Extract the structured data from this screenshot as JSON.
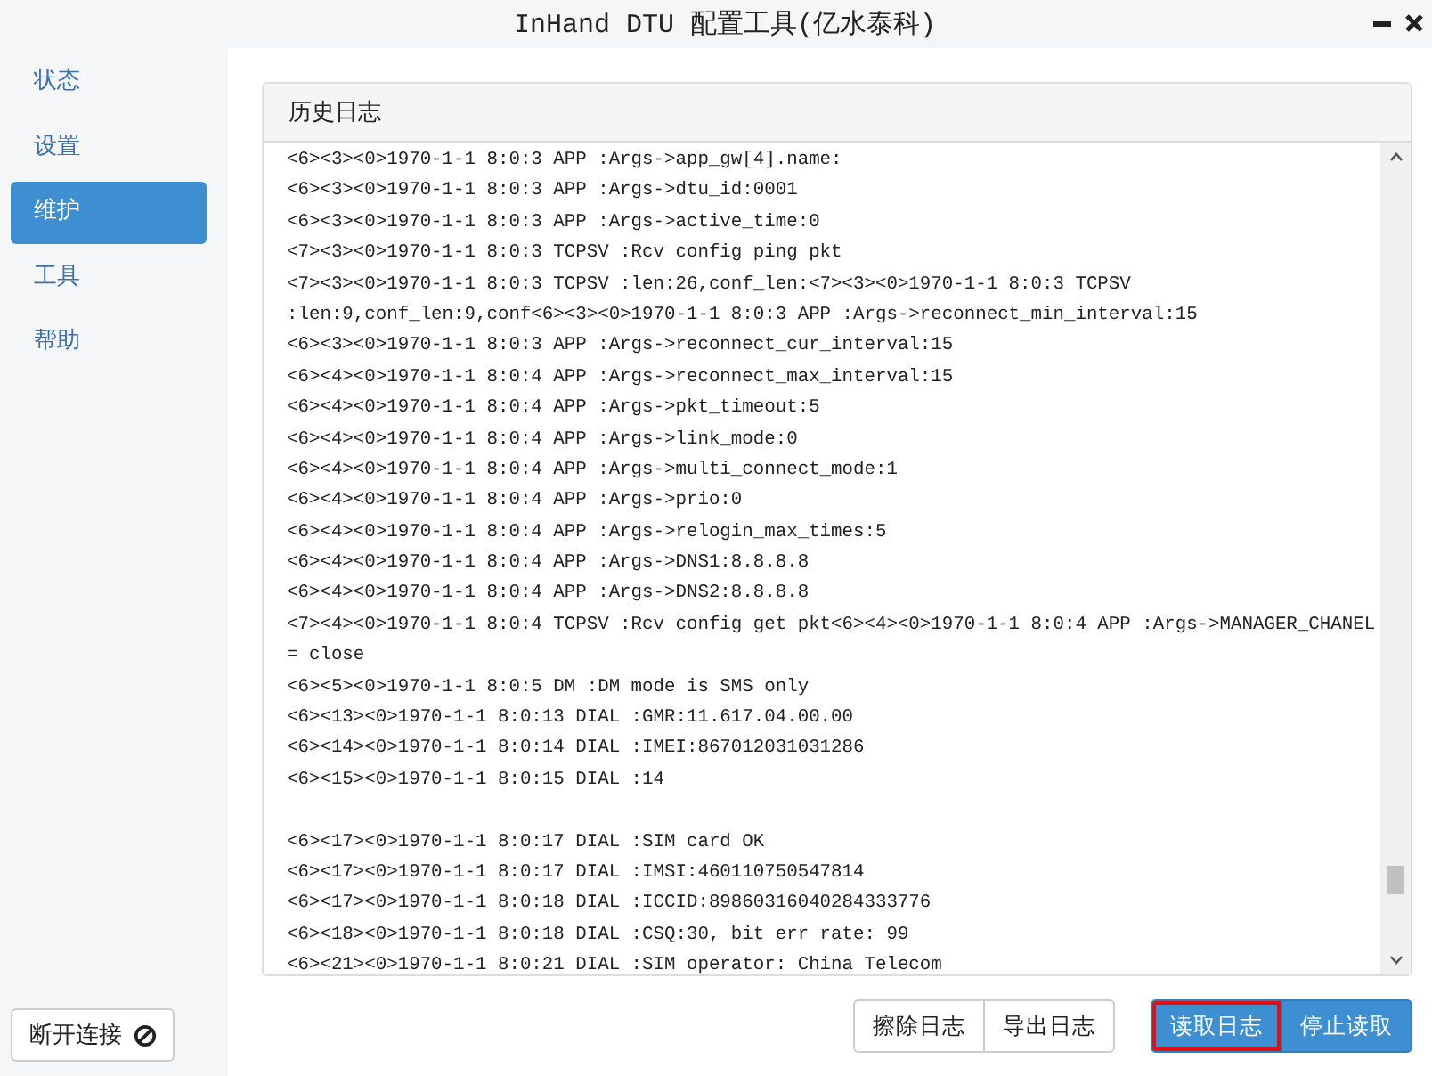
{
  "window": {
    "title": "InHand DTU 配置工具(亿水泰科)"
  },
  "sidebar": {
    "items": [
      {
        "label": "状态",
        "selected": false
      },
      {
        "label": "设置",
        "selected": false
      },
      {
        "label": "维护",
        "selected": true
      },
      {
        "label": "工具",
        "selected": false
      },
      {
        "label": "帮助",
        "selected": false
      }
    ],
    "disconnect_button": {
      "label": "断开连接"
    }
  },
  "log_panel": {
    "title": "历史日志",
    "blocks": [
      [
        "<6><3><0>1970-1-1 8:0:3 APP :Args->app_gw[4].name:",
        "<6><3><0>1970-1-1 8:0:3 APP :Args->dtu_id:0001",
        "<6><3><0>1970-1-1 8:0:3 APP :Args->active_time:0",
        "<7><3><0>1970-1-1 8:0:3 TCPSV :Rcv config ping pkt",
        "<7><3><0>1970-1-1 8:0:3 TCPSV :len:26,conf_len:<7><3><0>1970-1-1 8:0:3 TCPSV",
        ":len:9,conf_len:9,conf<6><3><0>1970-1-1 8:0:3 APP :Args->reconnect_min_interval:15",
        "<6><3><0>1970-1-1 8:0:3 APP :Args->reconnect_cur_interval:15",
        "<6><4><0>1970-1-1 8:0:4 APP :Args->reconnect_max_interval:15",
        "<6><4><0>1970-1-1 8:0:4 APP :Args->pkt_timeout:5",
        "<6><4><0>1970-1-1 8:0:4 APP :Args->link_mode:0",
        "<6><4><0>1970-1-1 8:0:4 APP :Args->multi_connect_mode:1",
        "<6><4><0>1970-1-1 8:0:4 APP :Args->prio:0",
        "<6><4><0>1970-1-1 8:0:4 APP :Args->relogin_max_times:5",
        "<6><4><0>1970-1-1 8:0:4 APP :Args->DNS1:8.8.8.8",
        "<6><4><0>1970-1-1 8:0:4 APP :Args->DNS2:8.8.8.8",
        "<7><4><0>1970-1-1 8:0:4 TCPSV :Rcv config get pkt<6><4><0>1970-1-1 8:0:4 APP :Args->MANAGER_CHANEL",
        "= close",
        "<6><5><0>1970-1-1 8:0:5 DM :DM mode is SMS only",
        "<6><13><0>1970-1-1 8:0:13 DIAL :GMR:11.617.04.00.00",
        "<6><14><0>1970-1-1 8:0:14 DIAL :IMEI:867012031031286",
        "<6><15><0>1970-1-1 8:0:15 DIAL :14"
      ],
      [
        "<6><17><0>1970-1-1 8:0:17 DIAL :SIM card OK",
        "<6><17><0>1970-1-1 8:0:17 DIAL :IMSI:460110750547814",
        "<6><17><0>1970-1-1 8:0:18 DIAL :ICCID:89860316040284333776",
        "<6><18><0>1970-1-1 8:0:18 DIAL :CSQ:30, bit err rate: 99",
        "<6><21><0>1970-1-1 8:0:21 DIAL :SIM operator: China Telecom"
      ]
    ]
  },
  "buttons": [
    {
      "label": "擦除日志",
      "primary": false,
      "highlighted": false
    },
    {
      "label": "导出日志",
      "primary": false,
      "highlighted": false
    },
    {
      "label": "读取日志",
      "primary": true,
      "highlighted": true
    },
    {
      "label": "停止读取",
      "primary": true,
      "highlighted": false
    }
  ]
}
